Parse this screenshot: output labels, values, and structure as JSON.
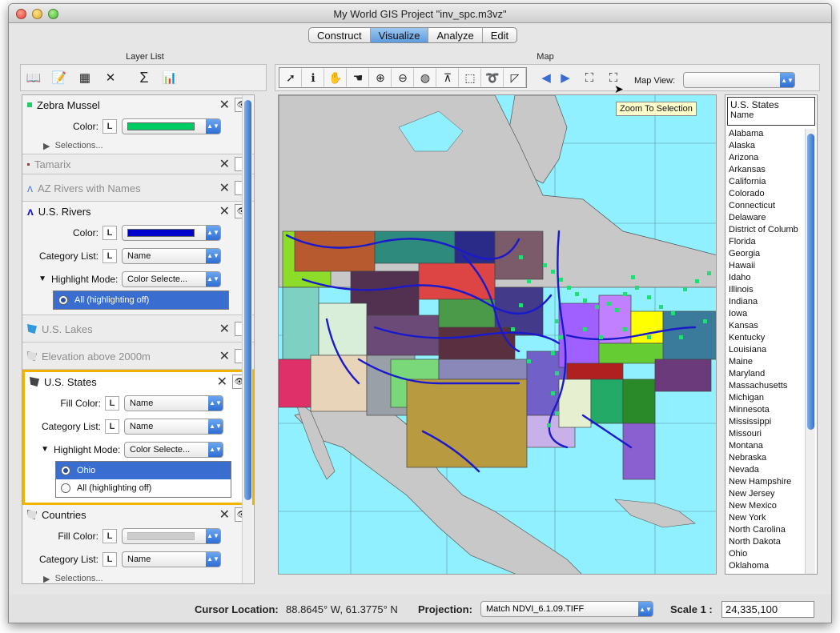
{
  "window": {
    "title": "My World GIS Project \"inv_spc.m3vz\""
  },
  "tabs": [
    "Construct",
    "Visualize",
    "Analyze",
    "Edit"
  ],
  "panels": {
    "layer_list": "Layer List",
    "map": "Map"
  },
  "map_view": {
    "label": "Map View:",
    "value": ""
  },
  "tooltip": "Zoom To Selection",
  "layers": {
    "zebra": {
      "name": "Zebra Mussel",
      "color_label": "Color:",
      "color": "#00cc66",
      "selections": "Selections..."
    },
    "tamarix": {
      "name": "Tamarix"
    },
    "azrivers": {
      "name": "AZ Rivers with Names"
    },
    "usrivers": {
      "name": "U.S. Rivers",
      "color_label": "Color:",
      "color": "#0000cc",
      "category_label": "Category List:",
      "category_value": "Name",
      "highlight_label": "Highlight Mode:",
      "highlight_value": "Color Selecte...",
      "option_all": "All (highlighting off)"
    },
    "uslakes": {
      "name": "U.S. Lakes"
    },
    "elevation": {
      "name": "Elevation above 2000m"
    },
    "usstates": {
      "name": "U.S. States",
      "fill_label": "Fill Color:",
      "fill_value": "Name",
      "category_label": "Category List:",
      "category_value": "Name",
      "highlight_label": "Highlight Mode:",
      "highlight_value": "Color Selecte...",
      "option_ohio": "Ohio",
      "option_all": "All (highlighting off)"
    },
    "countries": {
      "name": "Countries",
      "fill_label": "Fill Color:",
      "category_label": "Category List:",
      "category_value": "Name",
      "selections": "Selections..."
    }
  },
  "statelist": {
    "title": "U.S. States",
    "subtitle": "Name",
    "items": [
      "Alabama",
      "Alaska",
      "Arizona",
      "Arkansas",
      "California",
      "Colorado",
      "Connecticut",
      "Delaware",
      "District of Columb",
      "Florida",
      "Georgia",
      "Hawaii",
      "Idaho",
      "Illinois",
      "Indiana",
      "Iowa",
      "Kansas",
      "Kentucky",
      "Louisiana",
      "Maine",
      "Maryland",
      "Massachusetts",
      "Michigan",
      "Minnesota",
      "Mississippi",
      "Missouri",
      "Montana",
      "Nebraska",
      "Nevada",
      "New Hampshire",
      "New Jersey",
      "New Mexico",
      "New York",
      "North Carolina",
      "North Dakota",
      "Ohio",
      "Oklahoma"
    ]
  },
  "status": {
    "cursor_label": "Cursor Location:",
    "cursor_value": "88.8645° W, 61.3775° N",
    "projection_label": "Projection:",
    "projection_value": "Match NDVI_6.1.09.TIFF",
    "scale_label": "Scale 1 :",
    "scale_value": "24,335,100"
  },
  "colors": {
    "ocean": "#90f0ff",
    "land": "#c8c8c8",
    "river": "#1a1acc",
    "zebra": "#22cc66",
    "accent": "#3a6dd0",
    "selected_border": "#f2b200"
  }
}
